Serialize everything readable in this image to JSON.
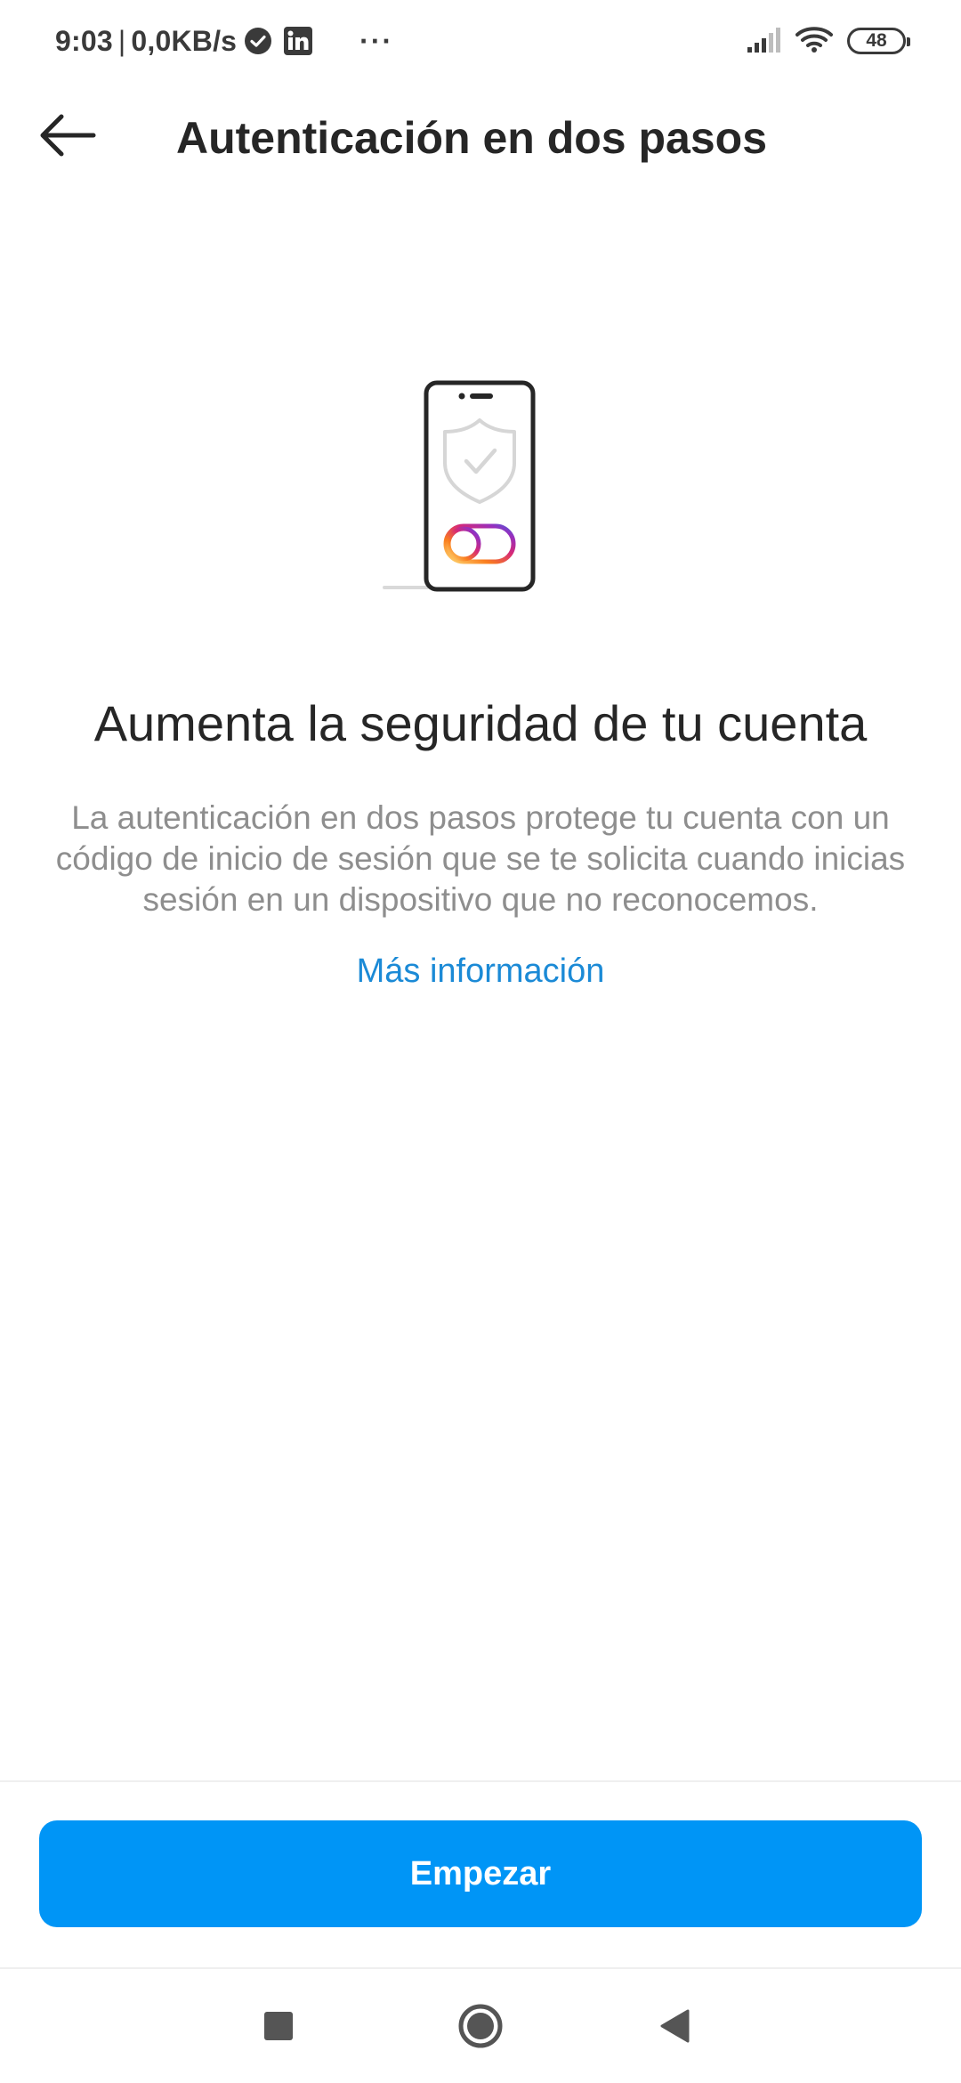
{
  "status_bar": {
    "time": "9:03",
    "separator": "|",
    "network_speed": "0,0KB/s",
    "more_dots": "···",
    "battery_level": "48",
    "icons": [
      "verified-check-icon",
      "linkedin-icon",
      "signal-icon",
      "wifi-icon",
      "battery-icon"
    ]
  },
  "header": {
    "title": "Autenticación en dos pasos",
    "back_icon": "arrow-left-icon"
  },
  "illustration": {
    "icon": "phone-shield-toggle-icon"
  },
  "content": {
    "headline": "Aumenta la seguridad de tu cuenta",
    "description": "La autenticación en dos pasos protege tu cuenta con un código de inicio de sesión que se te solicita cuando inicias sesión en un dispositivo que no reconocemos.",
    "link": "Más información"
  },
  "footer": {
    "primary_button": "Empezar"
  },
  "system_nav": {
    "icons": [
      "recents-square-icon",
      "home-circle-icon",
      "back-triangle-icon"
    ]
  },
  "colors": {
    "primary": "#0095f6",
    "link": "#1b8ad6",
    "text": "#262626",
    "secondary_text": "#8e8e8e"
  }
}
